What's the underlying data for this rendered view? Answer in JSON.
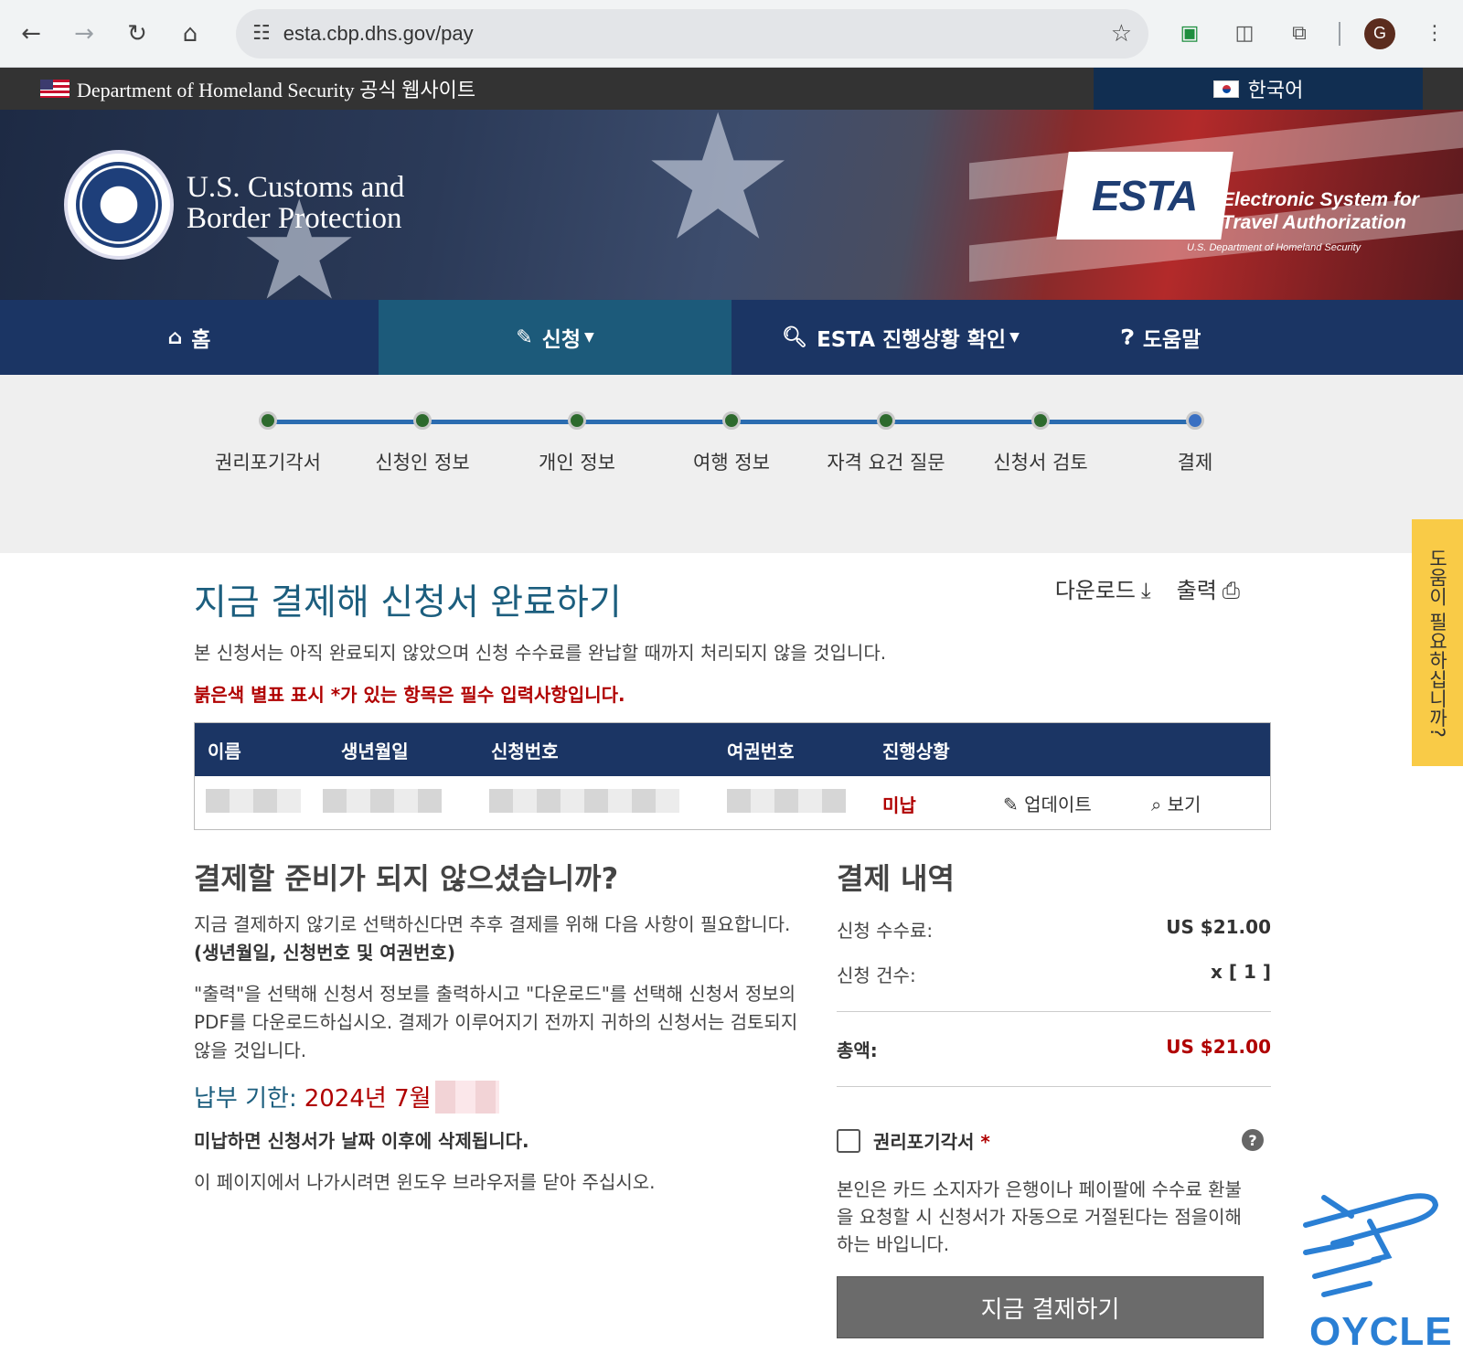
{
  "browser": {
    "url": "esta.cbp.dhs.gov/pay",
    "profile_initial": "G"
  },
  "gov_banner": {
    "text": "Department of Homeland Security 공식 웹사이트",
    "language": "한국어"
  },
  "header": {
    "agency_line1": "U.S. Customs and",
    "agency_line2": "Border Protection",
    "esta_logo": "ESTA",
    "esta_sub1": "Electronic System for",
    "esta_sub2": "Travel Authorization",
    "esta_dept": "U.S. Department of Homeland Security"
  },
  "nav": {
    "home": "홈",
    "apply": "신청",
    "status": "ESTA 진행상황 확인",
    "help": "도움말"
  },
  "steps": [
    "권리포기각서",
    "신청인 정보",
    "개인 정보",
    "여행 정보",
    "자격 요건 질문",
    "신청서 검토",
    "결제"
  ],
  "side_help": "도움이 필요하십니까?",
  "page": {
    "title": "지금 결제해 신청서 완료하기",
    "download": "다운로드",
    "print": "출력",
    "intro": "본 신청서는 아직 완료되지 않았으며 신청 수수료를 완납할 때까지 처리되지 않을 것입니다.",
    "required_note": "붉은색 별표 표시 *가 있는 항목은 필수 입력사항입니다."
  },
  "table": {
    "headers": [
      "이름",
      "생년월일",
      "신청번호",
      "여권번호",
      "진행상황"
    ],
    "status": "미납",
    "update": "업데이트",
    "view": "보기"
  },
  "not_ready": {
    "title": "결제할 준비가 되지 않으셨습니까?",
    "para1": "지금 결제하지 않기로 선택하신다면 추후 결제를 위해 다음 사항이 필요합니다.",
    "para1_bold": "(생년월일, 신청번호 및 여권번호)",
    "para2": "\"출력\"을 선택해 신청서 정보를 출력하시고 \"다운로드\"를 선택해 신청서 정보의 PDF를 다운로드하십시오. 결제가 이루어지기 전까지 귀하의 신청서는 검토되지 않을 것입니다.",
    "deadline_label": "납부 기한:",
    "deadline_value": "2024년 7월",
    "warning": "미납하면 신청서가 날짜 이후에 삭제됩니다.",
    "close_note": "이 페이지에서 나가시려면 윈도우 브라우저를 닫아 주십시오."
  },
  "payment": {
    "title": "결제 내역",
    "fee_label": "신청 수수료:",
    "fee_value": "US $21.00",
    "count_label": "신청 건수:",
    "count_value": "x [ 1 ]",
    "total_label": "총액:",
    "total_value": "US $21.00",
    "waiver_label": "권리포기각서",
    "waiver_required": "*",
    "waiver_text": "본인은 카드 소지자가 은행이나 페이팔에 수수료 환불을 요청할 시 신청서가 자동으로 거절된다는 점을이해하는 바입니다.",
    "pay_button": "지금 결제하기"
  },
  "watermark": "OYCLE"
}
